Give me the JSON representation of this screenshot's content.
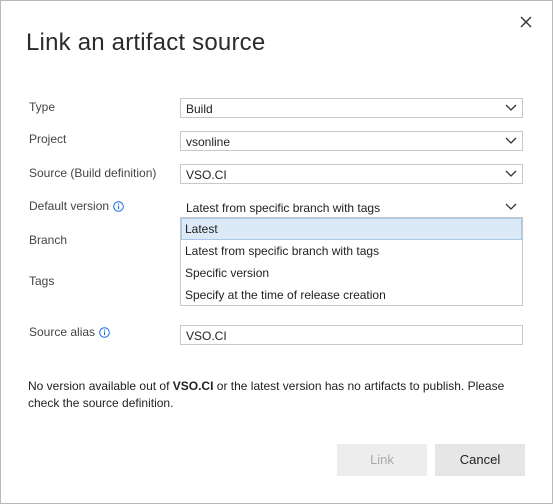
{
  "dialog": {
    "title": "Link an artifact source",
    "close_icon": "close-icon"
  },
  "form": {
    "type_label": "Type",
    "type_value": "Build",
    "project_label": "Project",
    "project_value": "vsonline",
    "source_label": "Source (Build definition)",
    "source_value": "VSO.CI",
    "default_version_label": "Default version",
    "default_version_value": "Latest from specific branch with tags",
    "branch_label": "Branch",
    "tags_label": "Tags",
    "source_alias_label": "Source alias",
    "source_alias_value": "VSO.CI"
  },
  "dropdown": {
    "options": [
      "Latest",
      "Latest from specific branch with tags",
      "Specific version",
      "Specify at the time of release creation"
    ],
    "selected_index": 0
  },
  "message": {
    "prefix": "No version available out of ",
    "definition": "VSO.CI",
    "suffix": " or the latest version has no artifacts to publish. Please check the source definition."
  },
  "buttons": {
    "link_label": "Link",
    "cancel_label": "Cancel"
  },
  "colors": {
    "selected_option_bg": "#dce9f7",
    "info_icon": "#1e6fd9"
  }
}
